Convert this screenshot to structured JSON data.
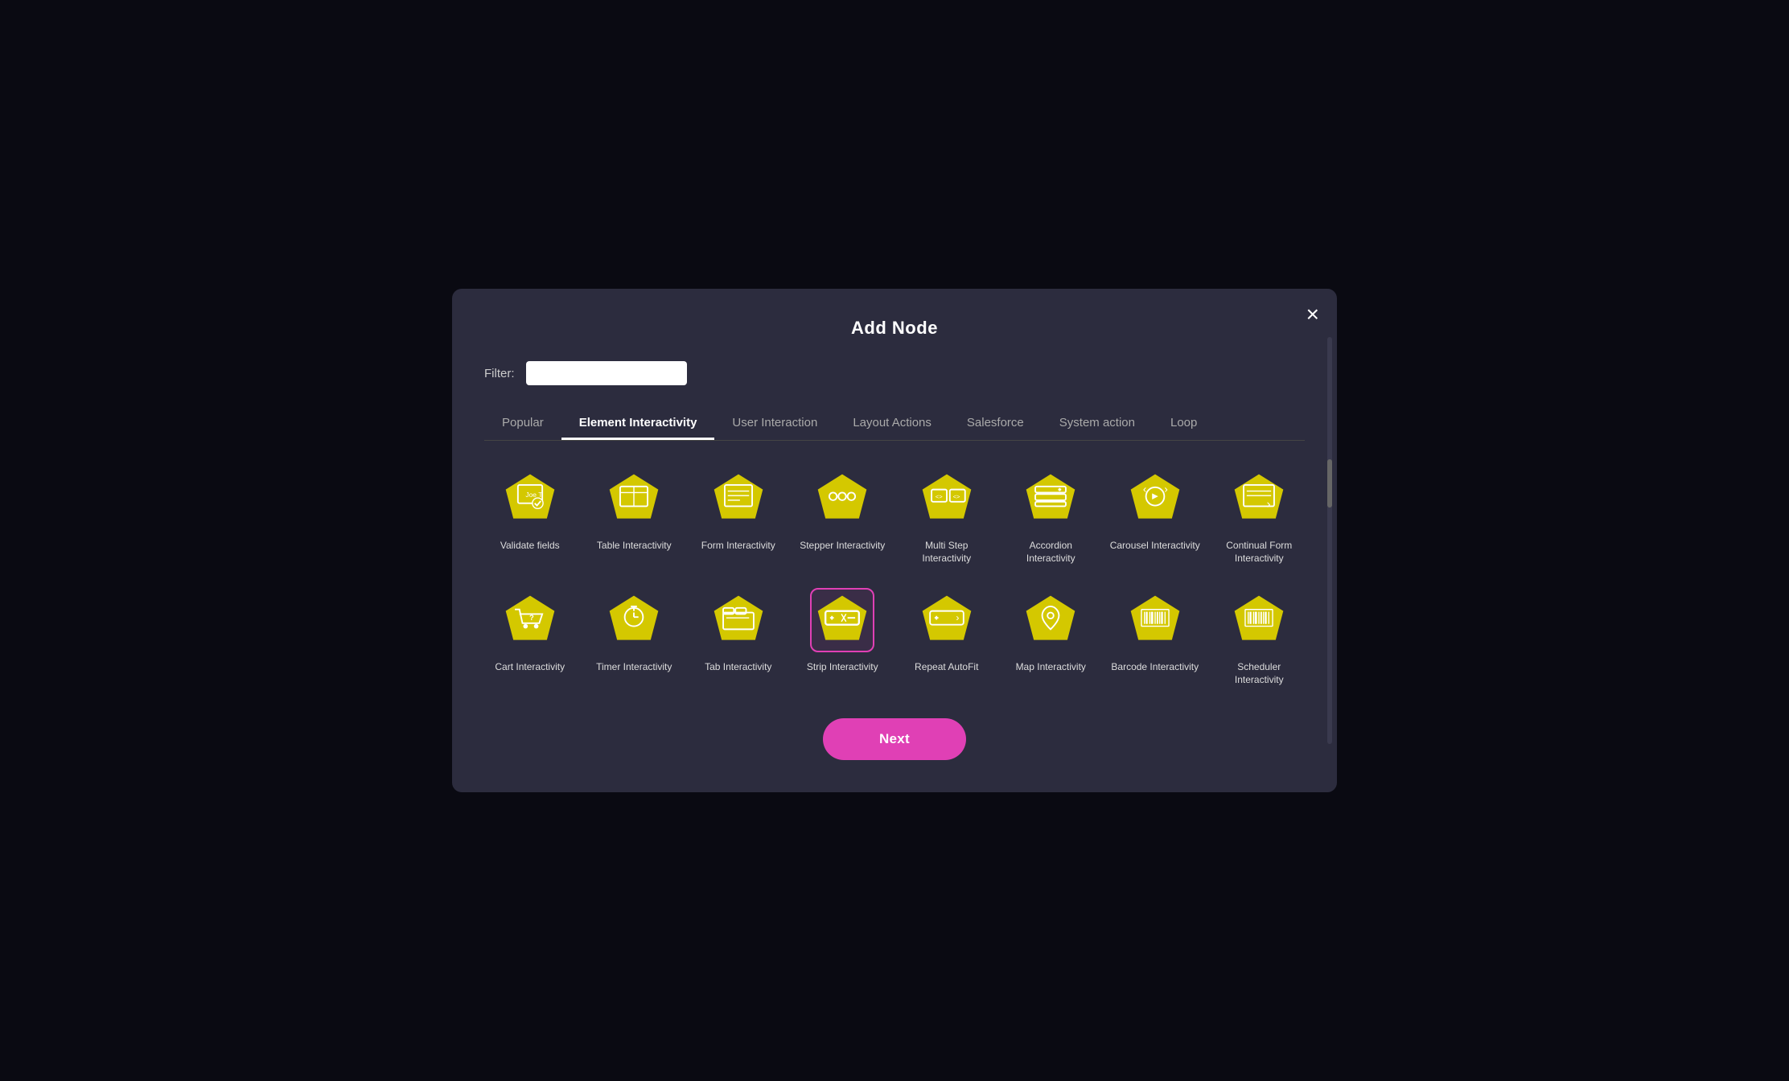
{
  "modal": {
    "title": "Add Node",
    "close_label": "×"
  },
  "filter": {
    "label": "Filter:",
    "placeholder": "",
    "value": ""
  },
  "tabs": [
    {
      "id": "popular",
      "label": "Popular",
      "active": false
    },
    {
      "id": "element-interactivity",
      "label": "Element Interactivity",
      "active": true
    },
    {
      "id": "user-interaction",
      "label": "User Interaction",
      "active": false
    },
    {
      "id": "layout-actions",
      "label": "Layout Actions",
      "active": false
    },
    {
      "id": "salesforce",
      "label": "Salesforce",
      "active": false
    },
    {
      "id": "system-action",
      "label": "System action",
      "active": false
    },
    {
      "id": "loop",
      "label": "Loop",
      "active": false
    }
  ],
  "nodes": [
    {
      "id": "validate-fields",
      "label": "Validate fields",
      "icon": "validate",
      "selected": false
    },
    {
      "id": "table-interactivity",
      "label": "Table Interactivity",
      "icon": "table",
      "selected": false
    },
    {
      "id": "form-interactivity",
      "label": "Form Interactivity",
      "icon": "form",
      "selected": false
    },
    {
      "id": "stepper-interactivity",
      "label": "Stepper Interactivity",
      "icon": "stepper",
      "selected": false
    },
    {
      "id": "multi-step-interactivity",
      "label": "Multi Step Interactivity",
      "icon": "multistep",
      "selected": false
    },
    {
      "id": "accordion-interactivity",
      "label": "Accordion Interactivity",
      "icon": "accordion",
      "selected": false
    },
    {
      "id": "carousel-interactivity",
      "label": "Carousel Interactivity",
      "icon": "carousel",
      "selected": false
    },
    {
      "id": "continual-form-interactivity",
      "label": "Continual Form Interactivity",
      "icon": "continualform",
      "selected": false
    },
    {
      "id": "cart-interactivity",
      "label": "Cart Interactivity",
      "icon": "cart",
      "selected": false
    },
    {
      "id": "timer-interactivity",
      "label": "Timer Interactivity",
      "icon": "timer",
      "selected": false
    },
    {
      "id": "tab-interactivity",
      "label": "Tab Interactivity",
      "icon": "tab",
      "selected": false
    },
    {
      "id": "strip-interactivity",
      "label": "Strip Interactivity",
      "icon": "strip",
      "selected": true
    },
    {
      "id": "repeat-autofit",
      "label": "Repeat AutoFit",
      "icon": "repeat",
      "selected": false
    },
    {
      "id": "map-interactivity",
      "label": "Map Interactivity",
      "icon": "map",
      "selected": false
    },
    {
      "id": "barcode-interactivity",
      "label": "Barcode Interactivity",
      "icon": "barcode",
      "selected": false
    },
    {
      "id": "scheduler-interactivity",
      "label": "Scheduler Interactivity",
      "icon": "scheduler",
      "selected": false
    }
  ],
  "next_button": {
    "label": "Next"
  },
  "colors": {
    "pentagon_fill": "#d4c800",
    "pentagon_fill_alt": "#c8b800",
    "selected_border": "#e040b5",
    "icon_stroke": "#ffffff"
  }
}
